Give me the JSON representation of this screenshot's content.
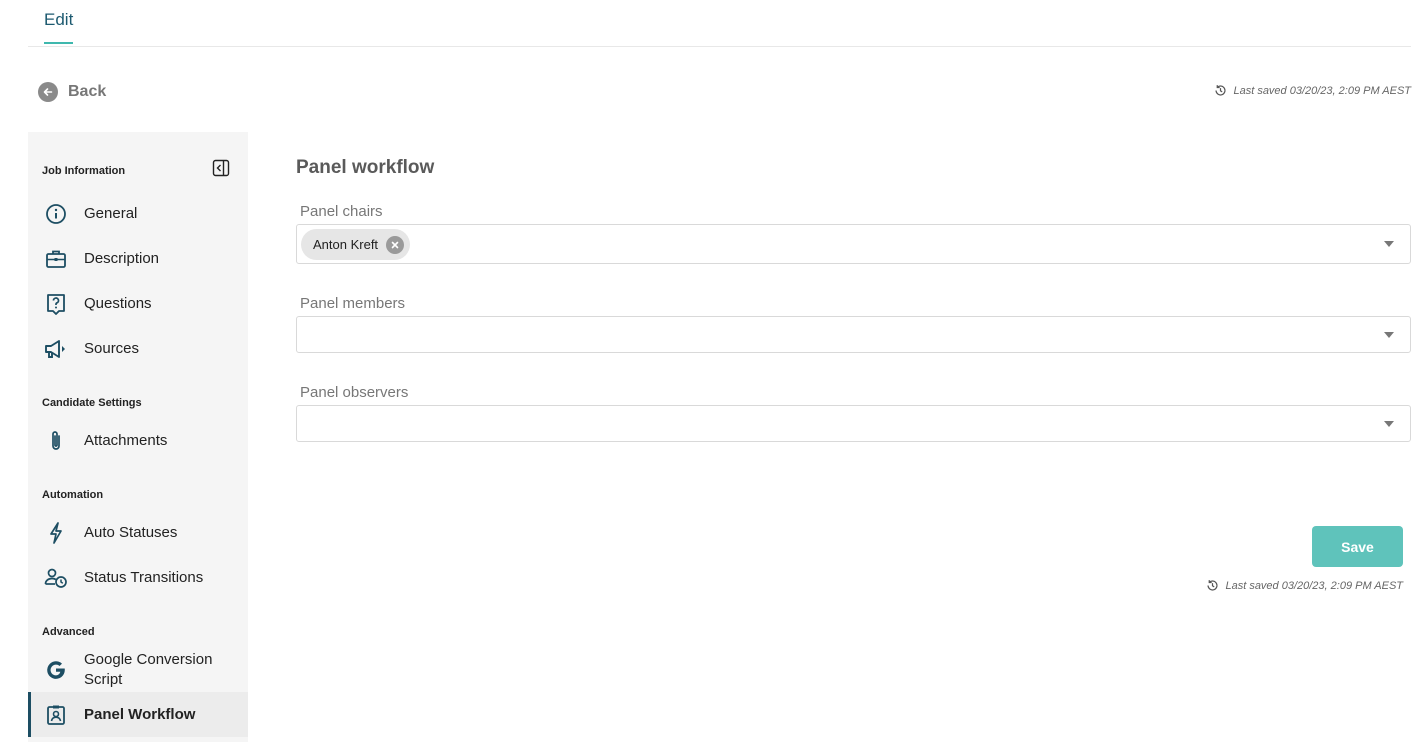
{
  "tabs": {
    "edit": "Edit"
  },
  "back": {
    "label": "Back"
  },
  "last_saved": "Last saved 03/20/23, 2:09 PM AEST",
  "sidebar": {
    "sections": {
      "job_information": "Job Information",
      "candidate_settings": "Candidate Settings",
      "automation": "Automation",
      "advanced": "Advanced"
    },
    "items": [
      {
        "label": "General",
        "icon": "info-icon"
      },
      {
        "label": "Description",
        "icon": "briefcase-icon"
      },
      {
        "label": "Questions",
        "icon": "question-icon"
      },
      {
        "label": "Sources",
        "icon": "megaphone-icon"
      },
      {
        "label": "Attachments",
        "icon": "paperclip-icon"
      },
      {
        "label": "Auto Statuses",
        "icon": "lightning-icon"
      },
      {
        "label": "Status Transitions",
        "icon": "user-clock-icon"
      },
      {
        "label": "Google Conversion Script",
        "icon": "google-icon"
      },
      {
        "label": "Panel Workflow",
        "icon": "badge-icon",
        "active": true
      }
    ]
  },
  "main": {
    "title": "Panel workflow",
    "panel_chairs": {
      "label": "Panel chairs",
      "chips": [
        "Anton Kreft"
      ]
    },
    "panel_members": {
      "label": "Panel members"
    },
    "panel_observers": {
      "label": "Panel observers"
    },
    "save_label": "Save"
  },
  "colors": {
    "accent": "#5fc3bb",
    "tab_underline": "#3fb8ae",
    "nav_icon": "#1d4e63"
  }
}
